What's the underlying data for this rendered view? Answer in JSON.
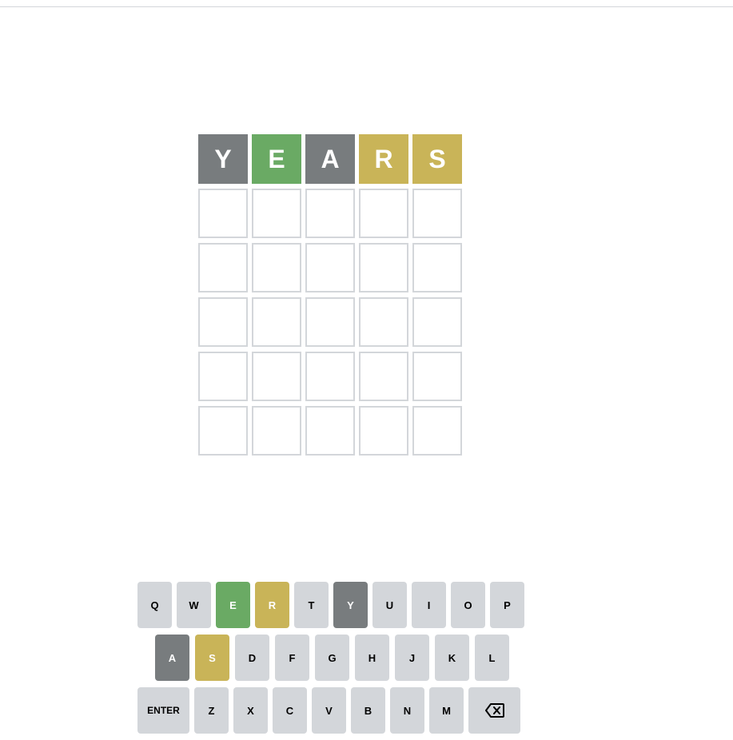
{
  "board": {
    "rows": [
      [
        {
          "letter": "Y",
          "state": "absent"
        },
        {
          "letter": "E",
          "state": "correct"
        },
        {
          "letter": "A",
          "state": "absent"
        },
        {
          "letter": "R",
          "state": "present"
        },
        {
          "letter": "S",
          "state": "present"
        }
      ],
      [
        {
          "letter": "",
          "state": "empty"
        },
        {
          "letter": "",
          "state": "empty"
        },
        {
          "letter": "",
          "state": "empty"
        },
        {
          "letter": "",
          "state": "empty"
        },
        {
          "letter": "",
          "state": "empty"
        }
      ],
      [
        {
          "letter": "",
          "state": "empty"
        },
        {
          "letter": "",
          "state": "empty"
        },
        {
          "letter": "",
          "state": "empty"
        },
        {
          "letter": "",
          "state": "empty"
        },
        {
          "letter": "",
          "state": "empty"
        }
      ],
      [
        {
          "letter": "",
          "state": "empty"
        },
        {
          "letter": "",
          "state": "empty"
        },
        {
          "letter": "",
          "state": "empty"
        },
        {
          "letter": "",
          "state": "empty"
        },
        {
          "letter": "",
          "state": "empty"
        }
      ],
      [
        {
          "letter": "",
          "state": "empty"
        },
        {
          "letter": "",
          "state": "empty"
        },
        {
          "letter": "",
          "state": "empty"
        },
        {
          "letter": "",
          "state": "empty"
        },
        {
          "letter": "",
          "state": "empty"
        }
      ],
      [
        {
          "letter": "",
          "state": "empty"
        },
        {
          "letter": "",
          "state": "empty"
        },
        {
          "letter": "",
          "state": "empty"
        },
        {
          "letter": "",
          "state": "empty"
        },
        {
          "letter": "",
          "state": "empty"
        }
      ]
    ]
  },
  "keyboard": {
    "rows": [
      [
        {
          "label": "Q",
          "state": "unused"
        },
        {
          "label": "W",
          "state": "unused"
        },
        {
          "label": "E",
          "state": "correct"
        },
        {
          "label": "R",
          "state": "present"
        },
        {
          "label": "T",
          "state": "unused"
        },
        {
          "label": "Y",
          "state": "absent"
        },
        {
          "label": "U",
          "state": "unused"
        },
        {
          "label": "I",
          "state": "unused"
        },
        {
          "label": "O",
          "state": "unused"
        },
        {
          "label": "P",
          "state": "unused"
        }
      ],
      [
        {
          "label": "A",
          "state": "absent"
        },
        {
          "label": "S",
          "state": "present"
        },
        {
          "label": "D",
          "state": "unused"
        },
        {
          "label": "F",
          "state": "unused"
        },
        {
          "label": "G",
          "state": "unused"
        },
        {
          "label": "H",
          "state": "unused"
        },
        {
          "label": "J",
          "state": "unused"
        },
        {
          "label": "K",
          "state": "unused"
        },
        {
          "label": "L",
          "state": "unused"
        }
      ],
      [
        {
          "label": "ENTER",
          "state": "unused",
          "wide": true
        },
        {
          "label": "Z",
          "state": "unused"
        },
        {
          "label": "X",
          "state": "unused"
        },
        {
          "label": "C",
          "state": "unused"
        },
        {
          "label": "V",
          "state": "unused"
        },
        {
          "label": "B",
          "state": "unused"
        },
        {
          "label": "N",
          "state": "unused"
        },
        {
          "label": "M",
          "state": "unused"
        },
        {
          "label": "",
          "state": "unused",
          "wide": true,
          "icon": "backspace-icon"
        }
      ]
    ]
  },
  "colors": {
    "correct": "#6aaa64",
    "present": "#c9b458",
    "absent": "#787c7e",
    "key_default": "#d3d6da",
    "tile_border": "#d3d6da"
  }
}
